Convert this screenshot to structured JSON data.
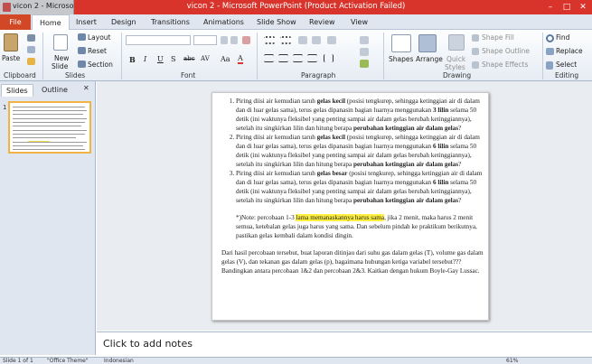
{
  "window": {
    "task_title": "vicon 2 - Microso",
    "title": "vicon 2 - Microsoft PowerPoint (Product Activation Failed)",
    "min": "–",
    "max": "□",
    "close": "✕"
  },
  "ribbon_tabs": [
    "File",
    "Home",
    "Insert",
    "Design",
    "Transitions",
    "Animations",
    "Slide Show",
    "Review",
    "View"
  ],
  "active_tab": "Home",
  "clipboard": {
    "paste": "Paste",
    "label": "Clipboard"
  },
  "slides_group": {
    "new_slide": "New",
    "new_slide2": "Slide",
    "layout": "Layout",
    "reset": "Reset",
    "section": "Section",
    "label": "Slides"
  },
  "font_group": {
    "bold": "B",
    "italic": "I",
    "underline": "U",
    "strike": "S",
    "shadow": "abc",
    "spacing": "AV",
    "case": "Aa",
    "color": "A",
    "label": "Font"
  },
  "paragraph_group": {
    "label": "Paragraph"
  },
  "drawing_group": {
    "shapes": "Shapes",
    "arrange": "Arrange",
    "quick": "Quick",
    "styles": "Styles",
    "fill": "Shape Fill",
    "outline": "Shape Outline",
    "effects": "Shape Effects",
    "label": "Drawing"
  },
  "editing_group": {
    "find": "Find",
    "replace": "Replace",
    "select": "Select",
    "label": "Editing"
  },
  "left_pane": {
    "tab_slides": "Slides",
    "tab_outline": "Outline",
    "close": "✕",
    "slide_number": "1"
  },
  "slide": {
    "items": [
      {
        "a": "Piring diisi air kemudian taruh ",
        "b": "gelas kecil",
        "c": " (posisi tengkurep, sehingga ketinggian air di dalam dan di luar gelas sama), terus gelas dipanasin bagian luarnya menggunakan ",
        "d": "3 lilin",
        "e": " selama 50 detik (ini waktunya fleksibel yang penting sampai air dalam gelas berubah ketinggiannya), setelah itu singkirkan lilin dan hitung berapa ",
        "f": "perubahan ketinggian air dalam gelas",
        "g": "?"
      },
      {
        "a": "Piring diisi air kemudian taruh ",
        "b": "gelas kecil",
        "c": " (posisi tengkurep, sehingga ketinggian air di dalam dan di luar gelas sama), terus gelas dipanasin bagian luarnya menggunakan ",
        "d": "6 lilin",
        "e": " selama 50 detik (ini waktunya fleksibel yang penting sampai air dalam gelas berubah ketinggiannya), setelah itu singkirkan lilin dan hitung berapa ",
        "f": "perubahan ketinggian air dalam gelas",
        "g": "?"
      },
      {
        "a": "Piring diisi air kemudian taruh ",
        "b": "gelas besar",
        "c": " (posisi tengkurep, sehingga ketinggian air di dalam dan di luar gelas sama), terus gelas dipanasin bagian luarnya menggunakan ",
        "d": "6 lilin",
        "e": " selama 50 detik (ini waktunya fleksibel yang penting sampai air dalam gelas berubah ketinggiannya), setelah itu singkirkan lilin dan hitung berapa ",
        "f": "perubahan ketinggian air dalam gelas",
        "g": "?"
      }
    ],
    "note_a": "*)Note: percobaan 1-3 ",
    "note_hl": "lama memanaskannya harus sama",
    "note_b": ", jika 2 menit, maka harus 2 menit semua, ketebalan gelas juga harus yang sama. Dan sebelum pindah ke praktikum berikutnya, pastikan gelas kembali dalam kondisi dingin.",
    "paragraph": "Dari hasil percobaan tersebut, buat laporan ditinjau dari suhu gas dalam gelas (T), volume gas dalam gelas (V), dan tekanan gas dalam gelas (p), bagaimana hubungan ketiga variabel tersebut??? Bandingkan antara percobaan 1&2 dan percobaan 2&3. Kaitkan dengan hukum Boyle-Gay Lussac."
  },
  "notes_placeholder": "Click to add notes",
  "status": {
    "slide": "Slide 1 of 1",
    "theme": "\"Office Theme\"",
    "language": "Indonesian",
    "zoom": "61%"
  }
}
